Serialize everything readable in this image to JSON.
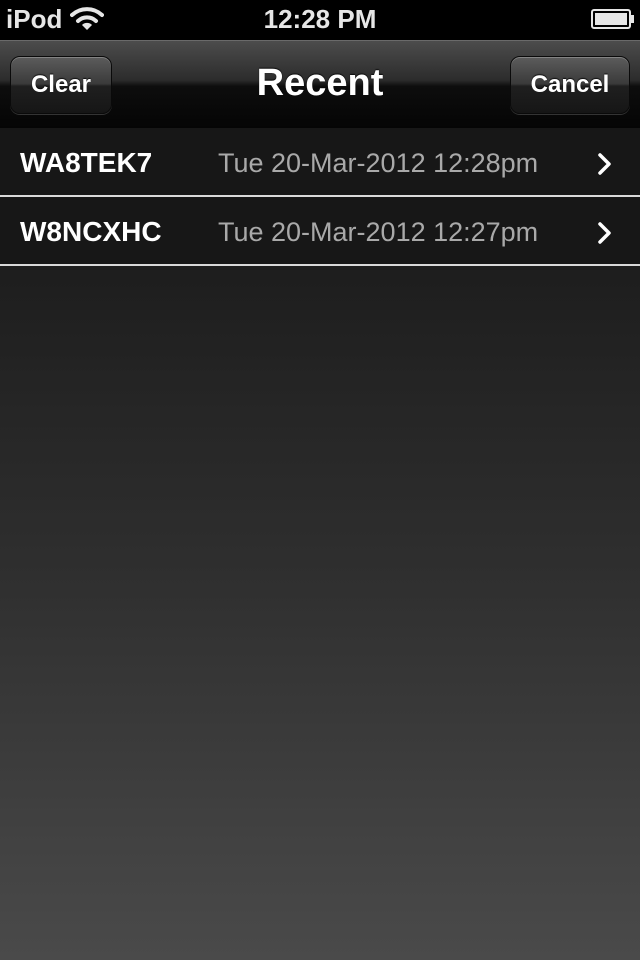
{
  "status_bar": {
    "carrier": "iPod",
    "time": "12:28 PM",
    "wifi_icon": "wifi-icon",
    "battery_icon": "battery-full-icon"
  },
  "nav": {
    "title": "Recent",
    "left_button": "Clear",
    "right_button": "Cancel"
  },
  "list": {
    "items": [
      {
        "callsign": "WA8TEK7",
        "timestamp": "Tue 20-Mar-2012 12:28pm",
        "icon": "chevron-right-icon"
      },
      {
        "callsign": "W8NCXHC",
        "timestamp": "Tue 20-Mar-2012 12:27pm",
        "icon": "chevron-right-icon"
      }
    ]
  },
  "colors": {
    "status_bar_bg": "#000000",
    "row_bg": "#171717",
    "row_separator": "#d9d9d9",
    "timestamp_text": "#a9a9a9",
    "text_primary": "#ffffff"
  }
}
